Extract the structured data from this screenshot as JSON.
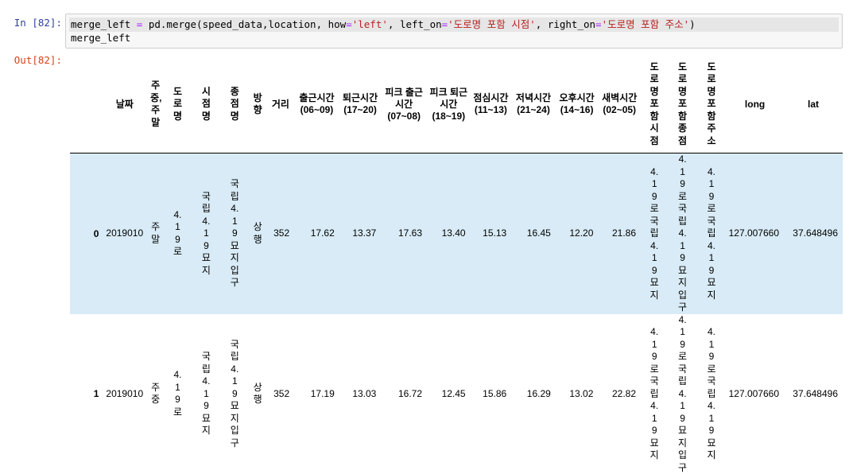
{
  "input_cell": {
    "prompt": "In [82]:",
    "code_line1": [
      {
        "t": "merge_left ",
        "c": "txt"
      },
      {
        "t": "=",
        "c": "op"
      },
      {
        "t": " pd.merge(speed_data,location, how",
        "c": "txt"
      },
      {
        "t": "=",
        "c": "op"
      },
      {
        "t": "'left'",
        "c": "str"
      },
      {
        "t": ", left_on",
        "c": "txt"
      },
      {
        "t": "=",
        "c": "op"
      },
      {
        "t": "'도로명 포함 시점'",
        "c": "str"
      },
      {
        "t": ", right_on",
        "c": "txt"
      },
      {
        "t": "=",
        "c": "op"
      },
      {
        "t": "'도로명 포함 주소'",
        "c": "str"
      },
      {
        "t": ")",
        "c": "txt"
      }
    ],
    "code_line2": "merge_left"
  },
  "output_cell": {
    "prompt": "Out[82]:"
  },
  "table": {
    "columns": [
      {
        "label": "날짜",
        "vertical": false
      },
      {
        "label": "주중,주말",
        "vertical": true
      },
      {
        "label": "도로명",
        "vertical": true
      },
      {
        "label": "시점명",
        "vertical": true
      },
      {
        "label": "종점명",
        "vertical": true
      },
      {
        "label": "방향",
        "vertical": true
      },
      {
        "label": "거리",
        "vertical": false
      },
      {
        "label": "출근시간 (06~09)",
        "vertical": false
      },
      {
        "label": "퇴근시간 (17~20)",
        "vertical": false
      },
      {
        "label": "피크 출근시간 (07~08)",
        "vertical": false
      },
      {
        "label": "피크 퇴근시간 (18~19)",
        "vertical": false
      },
      {
        "label": "점심시간 (11~13)",
        "vertical": false
      },
      {
        "label": "저녁시간 (21~24)",
        "vertical": false
      },
      {
        "label": "오후시간 (14~16)",
        "vertical": false
      },
      {
        "label": "새벽시간 (02~05)",
        "vertical": false
      },
      {
        "label": "도로명포함시점",
        "vertical": true
      },
      {
        "label": "도로명포함종점",
        "vertical": true
      },
      {
        "label": "도로명포함주소",
        "vertical": true
      },
      {
        "label": "long",
        "vertical": false
      },
      {
        "label": "lat",
        "vertical": false
      }
    ],
    "rows": [
      {
        "index": "0",
        "cells": [
          "2019010",
          "주말",
          "4.19로",
          "국립4.19묘지",
          "국립4.19묘지입구",
          "상행",
          "352",
          "17.62",
          "13.37",
          "17.63",
          "13.40",
          "15.13",
          "16.45",
          "12.20",
          "21.86",
          "4.19로국립4.19묘지",
          "4.19로국립4.19묘지입구",
          "4.19로국립4.19묘지",
          "127.007660",
          "37.648496"
        ]
      },
      {
        "index": "1",
        "cells": [
          "2019010",
          "주중",
          "4.19로",
          "국립4.19묘지",
          "국립4.19묘지입구",
          "상행",
          "352",
          "17.19",
          "13.03",
          "16.72",
          "12.45",
          "15.86",
          "16.29",
          "13.02",
          "22.82",
          "4.19로국립4.19묘지",
          "4.19로국립4.19묘지입구",
          "4.19로국립4.19묘지",
          "127.007660",
          "37.648496"
        ]
      }
    ]
  },
  "colors": {
    "in_prompt": "#303f9f",
    "out_prompt": "#d84315",
    "string_token": "#ba2121",
    "operator_token": "#aa22ff",
    "row_highlight": "#d8ebf6"
  }
}
